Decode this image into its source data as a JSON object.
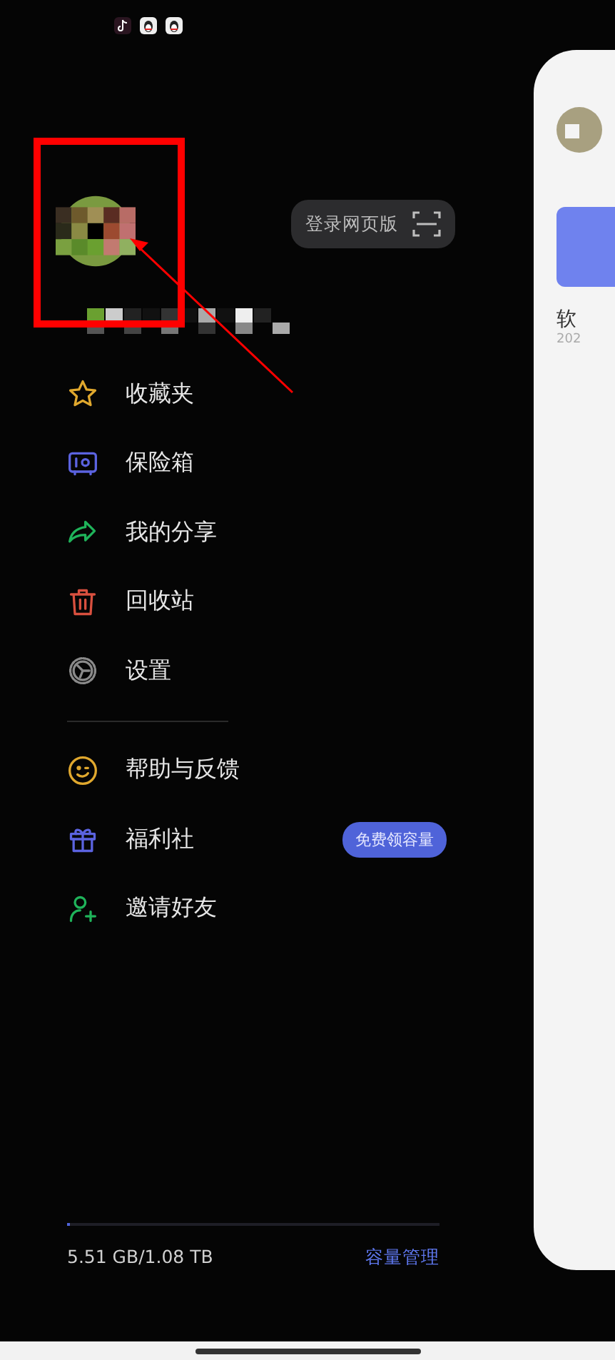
{
  "status_bar": {
    "notification_icons": [
      {
        "kind": "music"
      },
      {
        "kind": "penguin"
      },
      {
        "kind": "penguin"
      }
    ]
  },
  "profile": {
    "login_button": "登录网页版"
  },
  "menu": [
    {
      "kind": "star",
      "label": "收藏夹",
      "color": "#e0a82e"
    },
    {
      "kind": "safe",
      "label": "保险箱",
      "color": "#5b63e0"
    },
    {
      "kind": "share",
      "label": "我的分享",
      "color": "#1fb35a"
    },
    {
      "kind": "trash",
      "label": "回收站",
      "color": "#d9503f"
    },
    {
      "kind": "gear",
      "label": "设置",
      "color": "#8a8a8a"
    },
    {
      "kind": "divider"
    },
    {
      "kind": "smile",
      "label": "帮助与反馈",
      "color": "#e0a82e"
    },
    {
      "kind": "gift",
      "label": "福利社",
      "color": "#5b63e0",
      "badge": "免费领容量"
    },
    {
      "kind": "invite",
      "label": "邀请好友",
      "color": "#1fb35a"
    }
  ],
  "storage": {
    "level": 0.005,
    "usage": "5.51 GB/1.08 TB",
    "manage_link": "容量管理"
  },
  "side_panel": {
    "title": "软",
    "date": "202"
  }
}
